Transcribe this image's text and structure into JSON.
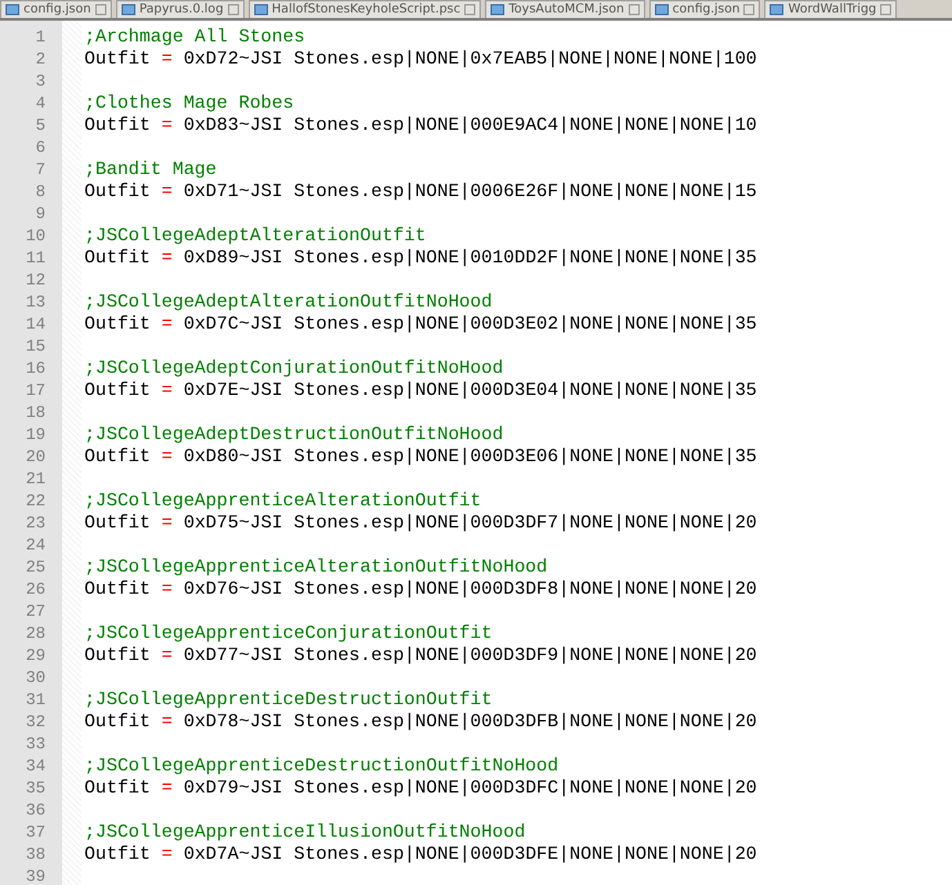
{
  "tabs": [
    {
      "label": "config.json",
      "selected": false
    },
    {
      "label": "Papyrus.0.log",
      "selected": false
    },
    {
      "label": "HallofStonesKeyholeScript.psc",
      "selected": false
    },
    {
      "label": "ToysAutoMCM.json",
      "selected": false
    },
    {
      "label": "config.json",
      "selected": false
    },
    {
      "label": "WordWallTrigg",
      "selected": false
    }
  ],
  "lines": [
    {
      "number": "1",
      "kind": "comment",
      "text": ";Archmage All Stones"
    },
    {
      "number": "2",
      "kind": "code",
      "key": "Outfit",
      "op": "=",
      "value": "0xD72~JSI Stones.esp|NONE|0x7EAB5|NONE|NONE|NONE|100"
    },
    {
      "number": "3",
      "kind": "blank"
    },
    {
      "number": "4",
      "kind": "comment",
      "text": ";Clothes Mage Robes"
    },
    {
      "number": "5",
      "kind": "code",
      "key": "Outfit",
      "op": "=",
      "value": "0xD83~JSI Stones.esp|NONE|000E9AC4|NONE|NONE|NONE|10"
    },
    {
      "number": "6",
      "kind": "blank"
    },
    {
      "number": "7",
      "kind": "comment",
      "text": ";Bandit Mage"
    },
    {
      "number": "8",
      "kind": "code",
      "key": "Outfit",
      "op": "=",
      "value": "0xD71~JSI Stones.esp|NONE|0006E26F|NONE|NONE|NONE|15"
    },
    {
      "number": "9",
      "kind": "blank"
    },
    {
      "number": "10",
      "kind": "comment",
      "text": ";JSCollegeAdeptAlterationOutfit"
    },
    {
      "number": "11",
      "kind": "code",
      "key": "Outfit",
      "op": "=",
      "value": "0xD89~JSI Stones.esp|NONE|0010DD2F|NONE|NONE|NONE|35"
    },
    {
      "number": "12",
      "kind": "blank"
    },
    {
      "number": "13",
      "kind": "comment",
      "text": ";JSCollegeAdeptAlterationOutfitNoHood"
    },
    {
      "number": "14",
      "kind": "code",
      "key": "Outfit",
      "op": "=",
      "value": "0xD7C~JSI Stones.esp|NONE|000D3E02|NONE|NONE|NONE|35"
    },
    {
      "number": "15",
      "kind": "blank"
    },
    {
      "number": "16",
      "kind": "comment",
      "text": ";JSCollegeAdeptConjurationOutfitNoHood"
    },
    {
      "number": "17",
      "kind": "code",
      "key": "Outfit",
      "op": "=",
      "value": "0xD7E~JSI Stones.esp|NONE|000D3E04|NONE|NONE|NONE|35"
    },
    {
      "number": "18",
      "kind": "blank"
    },
    {
      "number": "19",
      "kind": "comment",
      "text": ";JSCollegeAdeptDestructionOutfitNoHood"
    },
    {
      "number": "20",
      "kind": "code",
      "key": "Outfit",
      "op": "=",
      "value": "0xD80~JSI Stones.esp|NONE|000D3E06|NONE|NONE|NONE|35"
    },
    {
      "number": "21",
      "kind": "blank"
    },
    {
      "number": "22",
      "kind": "comment",
      "text": ";JSCollegeApprenticeAlterationOutfit"
    },
    {
      "number": "23",
      "kind": "code",
      "key": "Outfit",
      "op": "=",
      "value": "0xD75~JSI Stones.esp|NONE|000D3DF7|NONE|NONE|NONE|20"
    },
    {
      "number": "24",
      "kind": "blank"
    },
    {
      "number": "25",
      "kind": "comment",
      "text": ";JSCollegeApprenticeAlterationOutfitNoHood"
    },
    {
      "number": "26",
      "kind": "code",
      "key": "Outfit",
      "op": "=",
      "value": "0xD76~JSI Stones.esp|NONE|000D3DF8|NONE|NONE|NONE|20"
    },
    {
      "number": "27",
      "kind": "blank"
    },
    {
      "number": "28",
      "kind": "comment",
      "text": ";JSCollegeApprenticeConjurationOutfit"
    },
    {
      "number": "29",
      "kind": "code",
      "key": "Outfit",
      "op": "=",
      "value": "0xD77~JSI Stones.esp|NONE|000D3DF9|NONE|NONE|NONE|20"
    },
    {
      "number": "30",
      "kind": "blank"
    },
    {
      "number": "31",
      "kind": "comment",
      "text": ";JSCollegeApprenticeDestructionOutfit"
    },
    {
      "number": "32",
      "kind": "code",
      "key": "Outfit",
      "op": "=",
      "value": "0xD78~JSI Stones.esp|NONE|000D3DFB|NONE|NONE|NONE|20"
    },
    {
      "number": "33",
      "kind": "blank"
    },
    {
      "number": "34",
      "kind": "comment",
      "text": ";JSCollegeApprenticeDestructionOutfitNoHood"
    },
    {
      "number": "35",
      "kind": "code",
      "key": "Outfit",
      "op": "=",
      "value": "0xD79~JSI Stones.esp|NONE|000D3DFC|NONE|NONE|NONE|20"
    },
    {
      "number": "36",
      "kind": "blank"
    },
    {
      "number": "37",
      "kind": "comment",
      "text": ";JSCollegeApprenticeIllusionOutfitNoHood"
    },
    {
      "number": "38",
      "kind": "code",
      "key": "Outfit",
      "op": "=",
      "value": "0xD7A~JSI Stones.esp|NONE|000D3DFE|NONE|NONE|NONE|20"
    },
    {
      "number": "39",
      "kind": "blank"
    }
  ]
}
